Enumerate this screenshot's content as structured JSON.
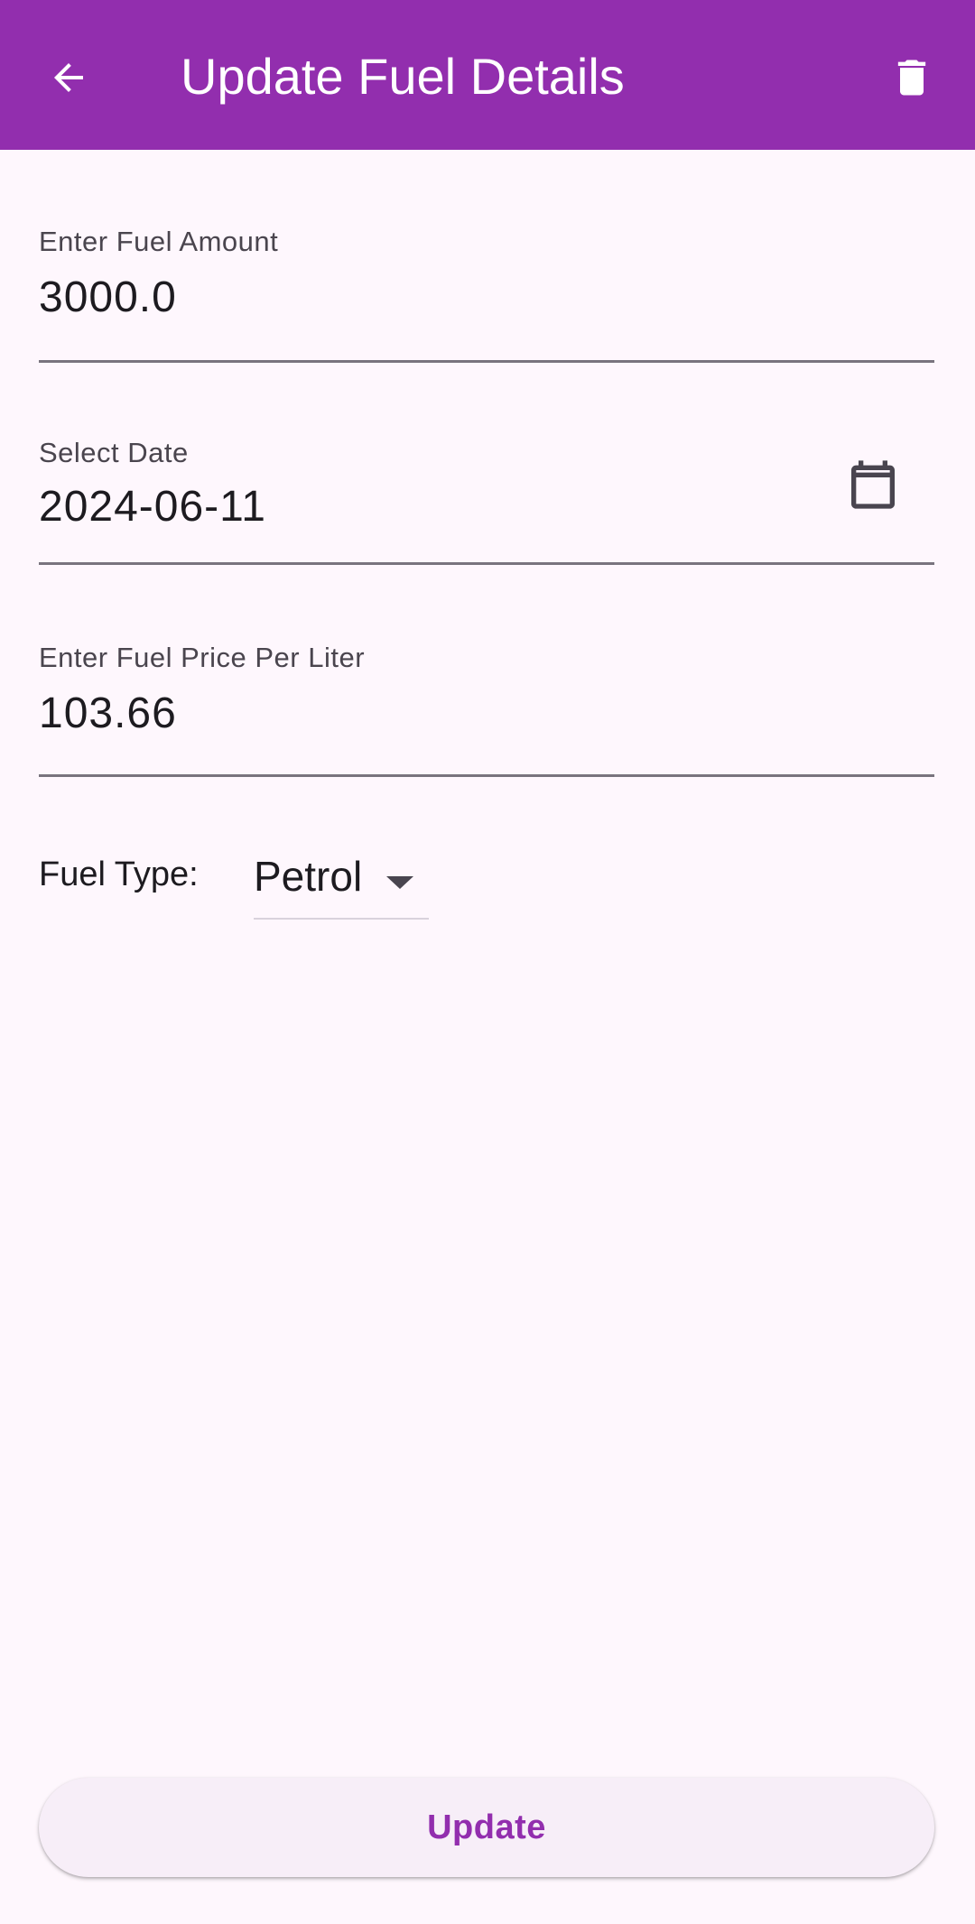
{
  "app_bar": {
    "title": "Update Fuel Details",
    "back_icon": "arrow-left-icon",
    "delete_icon": "trash-icon",
    "color": "#922eae"
  },
  "form": {
    "fuel_amount": {
      "label": "Enter Fuel Amount",
      "value": "3000.0"
    },
    "date": {
      "label": "Select Date",
      "value": "2024-06-11",
      "icon": "calendar-icon"
    },
    "price_per_liter": {
      "label": "Enter Fuel Price Per Liter",
      "value": "103.66"
    },
    "fuel_type": {
      "label": "Fuel Type:",
      "selected": "Petrol",
      "icon": "dropdown-arrow-icon"
    }
  },
  "actions": {
    "update_label": "Update"
  },
  "colors": {
    "primary": "#922eae",
    "background": "#fef7fd",
    "button_surface": "#f7eef8"
  }
}
